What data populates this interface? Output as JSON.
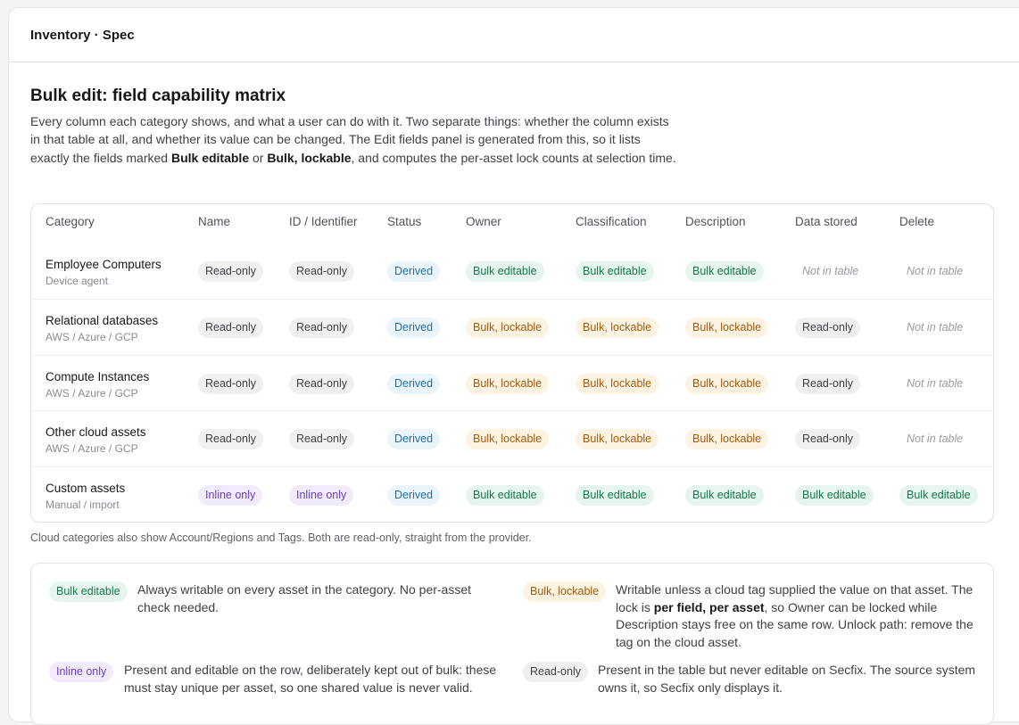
{
  "header": {
    "title": "Inventory · Spec"
  },
  "page": {
    "heading": "Bulk edit: field capability matrix",
    "intro": {
      "before": "Every column each category shows, and what a user can do with it. Two separate things: whether the column exists in that table at all, and whether its value can be changed. The Edit fields panel is generated from this, so it lists exactly the fields marked ",
      "term1": "Bulk editable",
      "middle": " or ",
      "term2": "Bulk, lockable",
      "after": ", and computes the per-asset lock counts at selection time."
    }
  },
  "table": {
    "columns": [
      "Category",
      "Name",
      "ID / Identifier",
      "Status",
      "Owner",
      "Classification",
      "Description",
      "Data stored",
      "Delete"
    ],
    "rows": [
      {
        "name": "Employee Computers",
        "sub": "Device agent",
        "cells": [
          {
            "label": "Read-only",
            "kind": "ro"
          },
          {
            "label": "Read-only",
            "kind": "ro"
          },
          {
            "label": "Derived",
            "kind": "der"
          },
          {
            "label": "Bulk editable",
            "kind": "be"
          },
          {
            "label": "Bulk editable",
            "kind": "be"
          },
          {
            "label": "Bulk editable",
            "kind": "be"
          },
          {
            "label": "Not in table",
            "kind": "nit"
          },
          {
            "label": "Not in table",
            "kind": "nit"
          }
        ]
      },
      {
        "name": "Relational databases",
        "sub": "AWS / Azure / GCP",
        "cells": [
          {
            "label": "Read-only",
            "kind": "ro"
          },
          {
            "label": "Read-only",
            "kind": "ro"
          },
          {
            "label": "Derived",
            "kind": "der"
          },
          {
            "label": "Bulk, lockable",
            "kind": "bl"
          },
          {
            "label": "Bulk, lockable",
            "kind": "bl"
          },
          {
            "label": "Bulk, lockable",
            "kind": "bl"
          },
          {
            "label": "Read-only",
            "kind": "ro"
          },
          {
            "label": "Not in table",
            "kind": "nit"
          }
        ]
      },
      {
        "name": "Compute Instances",
        "sub": "AWS / Azure / GCP",
        "cells": [
          {
            "label": "Read-only",
            "kind": "ro"
          },
          {
            "label": "Read-only",
            "kind": "ro"
          },
          {
            "label": "Derived",
            "kind": "der"
          },
          {
            "label": "Bulk, lockable",
            "kind": "bl"
          },
          {
            "label": "Bulk, lockable",
            "kind": "bl"
          },
          {
            "label": "Bulk, lockable",
            "kind": "bl"
          },
          {
            "label": "Read-only",
            "kind": "ro"
          },
          {
            "label": "Not in table",
            "kind": "nit"
          }
        ]
      },
      {
        "name": "Other cloud assets",
        "sub": "AWS / Azure / GCP",
        "cells": [
          {
            "label": "Read-only",
            "kind": "ro"
          },
          {
            "label": "Read-only",
            "kind": "ro"
          },
          {
            "label": "Derived",
            "kind": "der"
          },
          {
            "label": "Bulk, lockable",
            "kind": "bl"
          },
          {
            "label": "Bulk, lockable",
            "kind": "bl"
          },
          {
            "label": "Bulk, lockable",
            "kind": "bl"
          },
          {
            "label": "Read-only",
            "kind": "ro"
          },
          {
            "label": "Not in table",
            "kind": "nit"
          }
        ]
      },
      {
        "name": "Custom assets",
        "sub": "Manual / import",
        "cells": [
          {
            "label": "Inline only",
            "kind": "io"
          },
          {
            "label": "Inline only",
            "kind": "io"
          },
          {
            "label": "Derived",
            "kind": "der"
          },
          {
            "label": "Bulk editable",
            "kind": "be"
          },
          {
            "label": "Bulk editable",
            "kind": "be"
          },
          {
            "label": "Bulk editable",
            "kind": "be"
          },
          {
            "label": "Bulk editable",
            "kind": "be"
          },
          {
            "label": "Bulk editable",
            "kind": "be"
          }
        ]
      }
    ],
    "footnote": "Cloud categories also show Account/Regions and Tags. Both are read-only, straight from the provider."
  },
  "legend": {
    "items": [
      {
        "label": "Bulk editable",
        "kind": "be",
        "text": [
          {
            "t": "Always writable on every asset in the category. No per-asset check needed."
          }
        ]
      },
      {
        "label": "Bulk, lockable",
        "kind": "bl",
        "text": [
          {
            "t": "Writable unless a cloud tag supplied the value on that asset. The lock is "
          },
          {
            "t": "per field, per asset",
            "b": true
          },
          {
            "t": ", so Owner can be locked while Description stays free on the same row. Unlock path: remove the tag on the cloud asset."
          }
        ]
      },
      {
        "label": "Inline only",
        "kind": "io",
        "text": [
          {
            "t": "Present and editable on the row, deliberately kept out of bulk: these must stay unique per asset, so one shared value is never valid."
          }
        ]
      },
      {
        "label": "Read-only",
        "kind": "ro",
        "text": [
          {
            "t": "Present in the table but never editable on Secfix. The source system owns it, so Secfix only displays it."
          }
        ]
      }
    ]
  }
}
